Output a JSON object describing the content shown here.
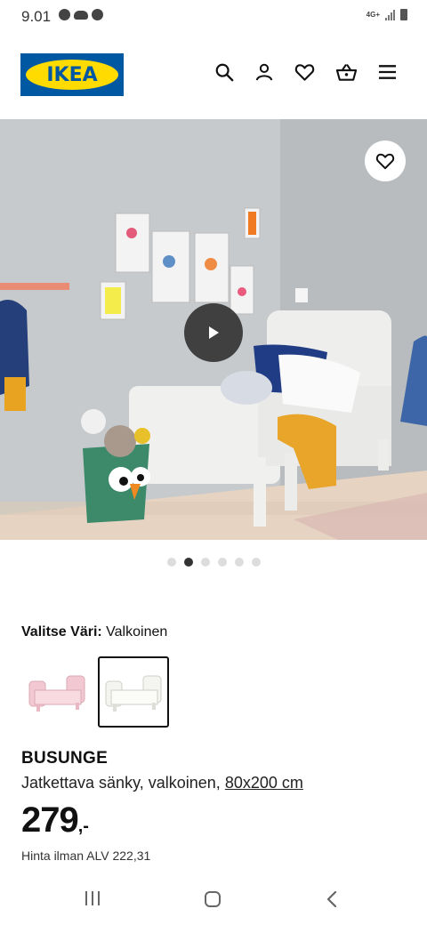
{
  "status_bar": {
    "time": "9.01",
    "network": "4G+"
  },
  "header": {
    "logo_text": "IKEA",
    "icons": [
      "search-icon",
      "user-icon",
      "heart-icon",
      "basket-icon",
      "menu-icon"
    ]
  },
  "hero": {
    "carousel_count": 6,
    "carousel_active_index": 1
  },
  "color_selector": {
    "label": "Valitse Väri:",
    "selected_value": "Valkoinen",
    "options": [
      {
        "color": "#f2c9d2",
        "selected": false
      },
      {
        "color": "#f4f4f0",
        "selected": true
      }
    ]
  },
  "product": {
    "name": "BUSUNGE",
    "description": "Jatkettava sänky, valkoinen,",
    "size": "80x200 cm",
    "price_int": "279",
    "price_dec": ",-",
    "vat_text": "Hinta ilman ALV 222,31"
  },
  "colors": {
    "ikea_blue": "#0058a3",
    "ikea_yellow": "#ffdb00"
  }
}
